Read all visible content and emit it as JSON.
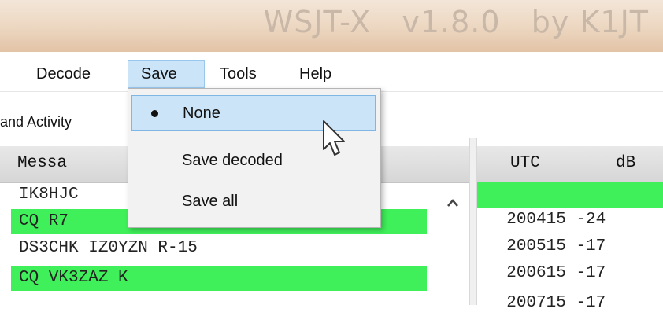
{
  "window": {
    "title": "WSJT-X   v1.8.0   by K1JT"
  },
  "menubar": {
    "items": [
      {
        "label": "Decode"
      },
      {
        "label": "Save"
      },
      {
        "label": "Tools"
      },
      {
        "label": "Help"
      }
    ]
  },
  "save_menu": {
    "items": [
      {
        "label": "None",
        "selected": true
      },
      {
        "label": "Save decoded"
      },
      {
        "label": "Save all"
      }
    ]
  },
  "left_panel": {
    "label": "and Activity",
    "header": "Messa",
    "rows": [
      {
        "text": "IK8HJC",
        "highlight": false
      },
      {
        "text": "CQ R7",
        "highlight": true
      },
      {
        "text": "DS3CHK IZ0YZN R-15",
        "highlight": false
      },
      {
        "text": "CQ VK3ZAZ K",
        "highlight": true
      }
    ]
  },
  "right_panel": {
    "header_utc": "UTC",
    "header_db": "dB",
    "rows": [
      {
        "utc": "200415",
        "db": "-24",
        "highlight": true
      },
      {
        "utc": "200515",
        "db": "-17",
        "highlight": false
      },
      {
        "utc": "200615",
        "db": "-17",
        "highlight": false
      },
      {
        "utc": "200715",
        "db": "-17",
        "highlight": false
      }
    ]
  },
  "colors": {
    "highlight_green": "#3ff05a",
    "menu_highlight": "#cce4f7"
  },
  "icons": [
    "scroll-up-arrow-icon",
    "radio-bullet-icon",
    "mouse-pointer-icon"
  ]
}
